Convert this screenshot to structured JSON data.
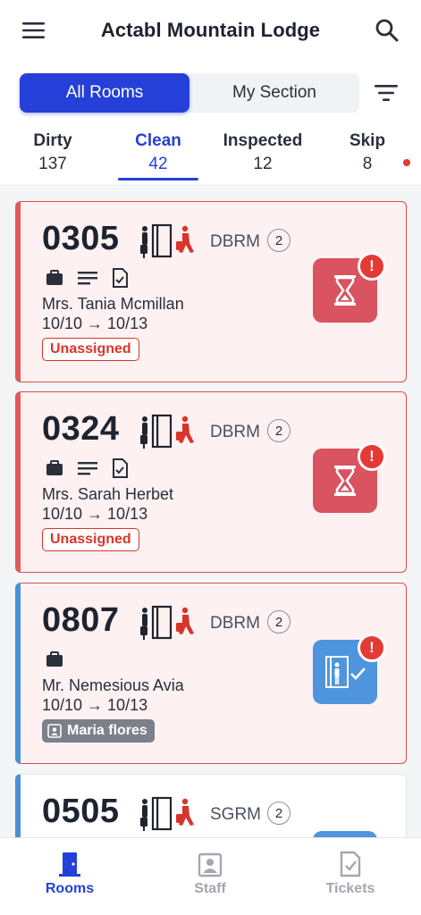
{
  "header": {
    "title": "Actabl Mountain Lodge"
  },
  "segment": {
    "all_rooms": "All Rooms",
    "my_section": "My Section"
  },
  "status_tabs": [
    {
      "label": "Dirty",
      "count": "137"
    },
    {
      "label": "Clean",
      "count": "42"
    },
    {
      "label": "Inspected",
      "count": "12"
    },
    {
      "label": "Skip",
      "count": "8"
    }
  ],
  "rooms": [
    {
      "number": "0305",
      "type": "DBRM",
      "guests": "2",
      "guest_name": "Mrs. Tania Mcmillan",
      "dates": "10/10 → 10/13",
      "assignment": "Unassigned",
      "status_icon": "hourglass-icon",
      "alert": "!"
    },
    {
      "number": "0324",
      "type": "DBRM",
      "guests": "2",
      "guest_name": "Mrs. Sarah Herbet",
      "dates": "10/10 → 10/13",
      "assignment": "Unassigned",
      "status_icon": "hourglass-icon",
      "alert": "!"
    },
    {
      "number": "0807",
      "type": "DBRM",
      "guests": "2",
      "guest_name": "Mr. Nemesious Avia",
      "dates": "10/10 → 10/13",
      "assignment": "Maria flores",
      "status_icon": "inspected-door-icon",
      "alert": "!"
    },
    {
      "number": "0505",
      "type": "SGRM",
      "guests": "2"
    }
  ],
  "bottom_nav": [
    {
      "label": "Rooms",
      "icon": "door-icon"
    },
    {
      "label": "Staff",
      "icon": "staff-badge-icon"
    },
    {
      "label": "Tickets",
      "icon": "ticket-icon"
    }
  ],
  "colors": {
    "primary": "#2440d9",
    "danger": "#e53935",
    "card_red_bg": "#fdf1f1",
    "status_red": "#d95361",
    "status_blue": "#4e95dd"
  }
}
